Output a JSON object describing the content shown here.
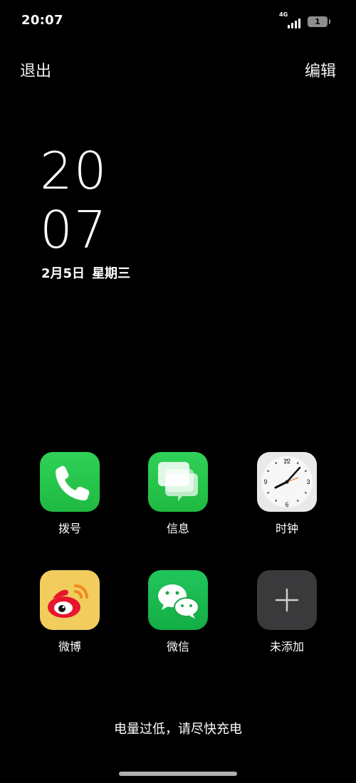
{
  "status": {
    "time": "20:07",
    "network": "4G",
    "battery_level": "1"
  },
  "actions": {
    "exit_label": "退出",
    "edit_label": "编辑"
  },
  "clock": {
    "hour": "20",
    "minute": "07",
    "date": "2月5日",
    "weekday": "星期三"
  },
  "apps": [
    {
      "label": "拨号",
      "icon": "phone-icon"
    },
    {
      "label": "信息",
      "icon": "messages-icon"
    },
    {
      "label": "时钟",
      "icon": "clock-icon"
    },
    {
      "label": "微博",
      "icon": "weibo-icon"
    },
    {
      "label": "微信",
      "icon": "wechat-icon"
    },
    {
      "label": "未添加",
      "icon": "add-icon"
    }
  ],
  "notice": "电量过低，请尽快充电",
  "colors": {
    "background": "#000000",
    "app_green": "#30d158",
    "weibo_yellow": "#f2cd5e",
    "add_gray": "#3a3a3c"
  }
}
